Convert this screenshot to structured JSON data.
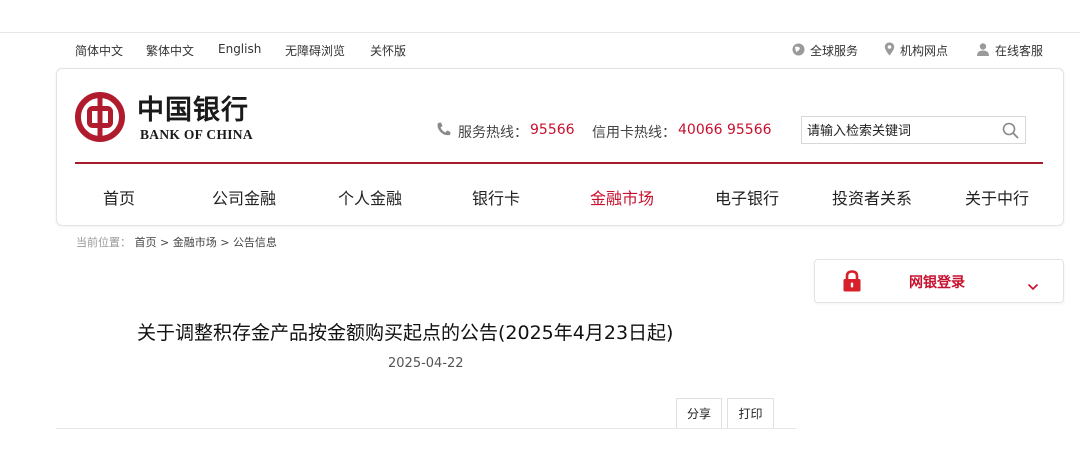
{
  "utility_nav": {
    "languages": [
      "简体中文",
      "繁体中文",
      "English"
    ],
    "accessibility": "无障碍浏览",
    "care_mode": "关怀版",
    "global_service": "全球服务",
    "branches": "机构网点",
    "online_service": "在线客服"
  },
  "brand": {
    "name_cn": "中国银行",
    "name_en": "BANK OF CHINA",
    "color": "#c8102e"
  },
  "hotlines": {
    "service_label": "服务热线：",
    "service_number": "95566",
    "card_label": "信用卡热线：",
    "card_number": "40066 95566"
  },
  "search": {
    "placeholder": "请输入检索关键词",
    "icon": "search-icon"
  },
  "main_nav": {
    "items": [
      "首页",
      "公司金融",
      "个人金融",
      "银行卡",
      "金融市场",
      "电子银行",
      "投资者关系",
      "关于中行"
    ],
    "active": "金融市场"
  },
  "breadcrumb": {
    "prefix": "当前位置：",
    "home": "首页",
    "sep": ">",
    "section": "金融市场",
    "current": "公告信息"
  },
  "ebank_login": {
    "label": "网银登录",
    "icon": "lock-icon"
  },
  "article": {
    "title": "关于调整积存金产品按金额购买起点的公告(2025年4月23日起)",
    "date": "2025-04-22",
    "share_label": "分享",
    "print_label": "打印"
  }
}
